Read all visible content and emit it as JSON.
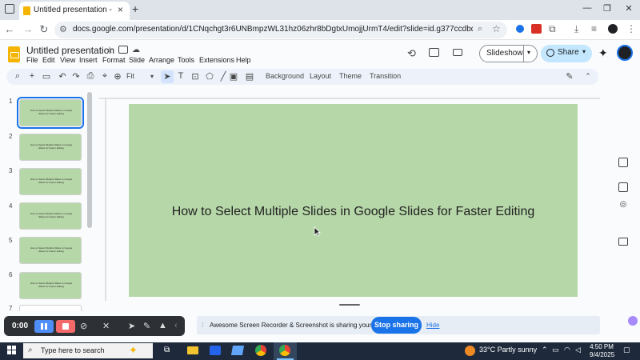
{
  "browser": {
    "tab_title": "Untitled presentation - Google",
    "tab_close": "×",
    "new_tab": "+",
    "url": "docs.google.com/presentation/d/1CNqchgt3r6UNBmpzWL31hz06zhr8bDgtxUmojjUrmT4/edit?slide=id.g377ccdbdee5_0_0#slide=id.g3...",
    "window_controls": [
      "—",
      "❐",
      "✕"
    ],
    "nav": [
      "←",
      "→",
      "↻"
    ]
  },
  "docs": {
    "title": "Untitled presentation",
    "menu": [
      "File",
      "Edit",
      "View",
      "Insert",
      "Format",
      "Slide",
      "Arrange",
      "Tools",
      "Extensions",
      "Help"
    ],
    "slideshow_label": "Slideshow",
    "share_label": "Share"
  },
  "toolbar": {
    "zoom": "Fit",
    "background": "Background",
    "layout": "Layout",
    "theme": "Theme",
    "transition": "Transition"
  },
  "slides": [
    {
      "number": "1",
      "title": "How to Select Multiple Slides in Google Slides for Faster Editing",
      "selected": true
    },
    {
      "number": "2",
      "title": "How to Select Multiple Slides in Google Slides for Faster Editing",
      "selected": false
    },
    {
      "number": "3",
      "title": "How to Select Multiple Slides in Google Slides for Faster Editing",
      "selected": false
    },
    {
      "number": "4",
      "title": "How to Select Multiple Slides in Google Slides for Faster Editing",
      "selected": false
    },
    {
      "number": "5",
      "title": "How to Select Multiple Slides in Google Slides for Faster Editing",
      "selected": false
    },
    {
      "number": "6",
      "title": "How to Select Multiple Slides in Google Slides for Faster Editing",
      "selected": false
    },
    {
      "number": "7",
      "title": "",
      "selected": false
    }
  ],
  "current_slide": {
    "title": "How to Select Multiple Slides in Google Slides for Faster Editing",
    "background_color": "#b6d7a8"
  },
  "recorder": {
    "time": "0:00"
  },
  "share_notice": {
    "message": "Awesome Screen Recorder & Screenshot is sharing your screen.",
    "stop_label": "Stop sharing",
    "hide_label": "Hide"
  },
  "taskbar": {
    "search_placeholder": "Type here to search",
    "weather": "33°C  Partly sunny",
    "time": "4:50 PM",
    "date": "9/4/2025"
  },
  "colors": {
    "accent": "#1a73e8",
    "slide_bg": "#b6d7a8",
    "share_btn": "#c2e7ff"
  }
}
